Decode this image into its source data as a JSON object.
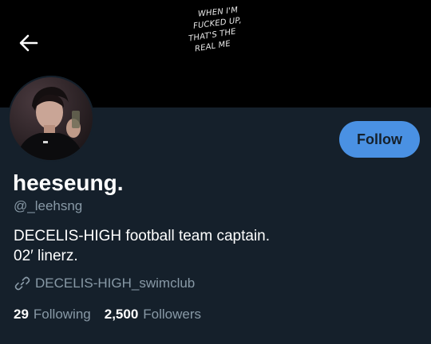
{
  "header": {
    "back_icon": "arrow-left-icon",
    "banner_lines": [
      "WHEN  I'M",
      "FUCKED UP,",
      "THAT'S THE",
      "REAL ME"
    ]
  },
  "profile": {
    "avatar_icon": "avatar-photo",
    "name": "heeseung.",
    "handle": "@_leehsng",
    "bio_lines": [
      "DECELIS-HIGH football team captain.",
      "02′ linerz."
    ],
    "website_icon": "link-icon",
    "website": "DECELIS-HIGH_swimclub"
  },
  "actions": {
    "follow_label": "Follow"
  },
  "stats": {
    "following_count": "29",
    "following_label": "Following",
    "followers_count": "2,500",
    "followers_label": "Followers"
  },
  "colors": {
    "background": "#15202b",
    "banner": "#000000",
    "accent": "#4a91e3",
    "secondary_text": "#8899a6",
    "primary_text": "#ffffff"
  }
}
